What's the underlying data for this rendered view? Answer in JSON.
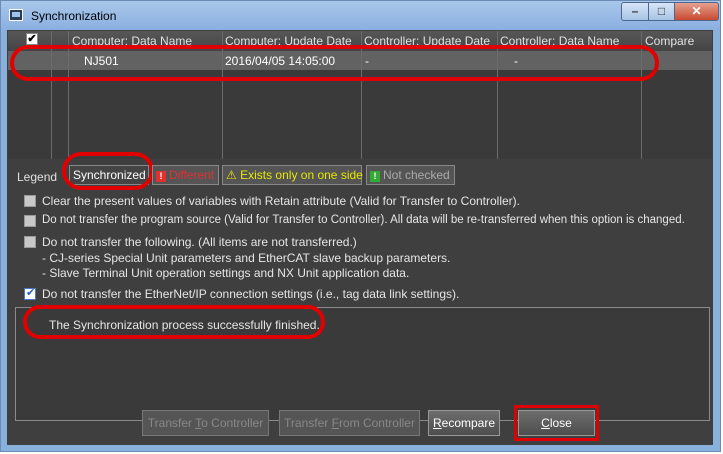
{
  "window": {
    "title": "Synchronization"
  },
  "controls": {
    "minimize": "–",
    "maximize": "□",
    "close": "✕"
  },
  "table": {
    "columns": [
      "",
      "",
      "Computer: Data Name",
      "Computer: Update Date",
      "Controller: Update Date",
      "Controller: Data Name",
      "Compare"
    ],
    "rows": [
      {
        "checked": true,
        "computer_data_name": "NJ501",
        "computer_update_date": "2016/04/05 14:05:00",
        "controller_update_date": "-",
        "controller_data_name": "-",
        "compare": ""
      }
    ]
  },
  "legend": {
    "label": "Legend",
    "synchronized": "Synchronized",
    "different": "Different",
    "one_side": "Exists only on one side",
    "not_checked": "Not checked",
    "colors": {
      "different": "#e03030",
      "one_side": "#e6e600",
      "not_checked": "#33aa33"
    }
  },
  "options": {
    "clear_retain": {
      "checked": false,
      "label": "Clear the present values of variables with Retain attribute (Valid for Transfer to Controller)."
    },
    "no_program_source": {
      "checked": false,
      "label": "Do not transfer the program source (Valid for Transfer to Controller). All data will be re-transferred when this option is changed."
    },
    "no_transfer_following": {
      "checked": false,
      "label": "Do not transfer the following. (All items are not transferred.)",
      "detail1": "- CJ-series Special Unit parameters and EtherCAT slave backup parameters.",
      "detail2": "- Slave Terminal Unit operation settings and NX Unit application data."
    },
    "no_ethernetip": {
      "checked": true,
      "label": "Do not transfer the EtherNet/IP connection settings (i.e., tag data link settings)."
    }
  },
  "status_message": "The Synchronization process successfully finished.",
  "buttons": {
    "transfer_to": {
      "pre": "Transfer ",
      "key": "T",
      "post": "o Controller"
    },
    "transfer_from": {
      "pre": "Transfer ",
      "key": "F",
      "post": "rom Controller"
    },
    "recompare": {
      "pre": "",
      "key": "R",
      "post": "ecompare"
    },
    "close": {
      "pre": "",
      "key": "C",
      "post": "lose"
    }
  }
}
